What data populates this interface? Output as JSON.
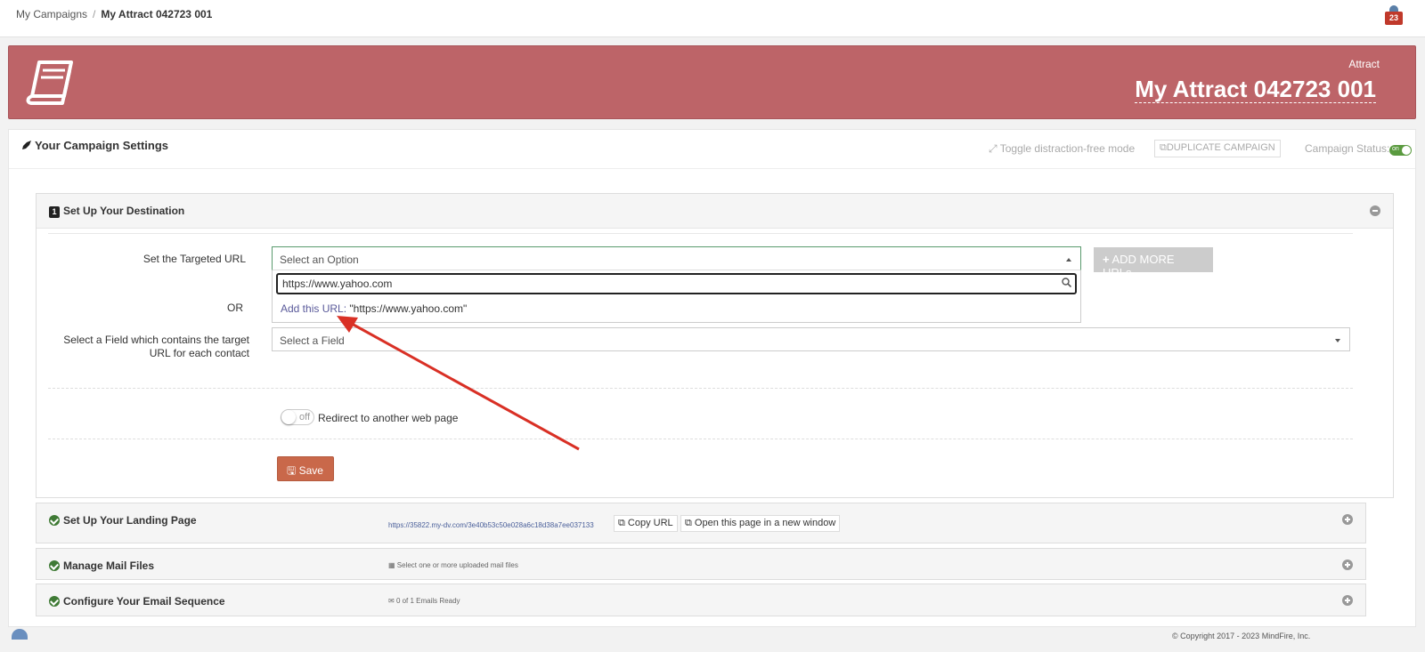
{
  "breadcrumb": {
    "root": "My Campaigns",
    "separator": "/",
    "current": "My Attract 042723 001"
  },
  "notifications": {
    "count": "23"
  },
  "banner": {
    "type": "Attract",
    "campaign_name": "My Attract 042723 001",
    "color": "#bd6468"
  },
  "settings": {
    "title": "Your Campaign Settings",
    "toggle_mode": "Toggle distraction-free mode",
    "duplicate": "DUPLICATE CAMPAIGN",
    "status_label": "Campaign Status:",
    "status_value": "on"
  },
  "destination": {
    "step": "1",
    "title": "Set Up Your Destination",
    "targeted_url_label": "Set the Targeted URL",
    "select_placeholder": "Select an Option",
    "search_value": "https://www.yahoo.com",
    "add_url_prefix": "Add this URL:",
    "add_url_value": " \"https://www.yahoo.com\"",
    "add_more": "ADD MORE URLs",
    "or_label": "OR",
    "field_label": "Select a Field which contains the target URL for each contact",
    "field_placeholder": "Select a Field",
    "redirect_toggle": "off",
    "redirect_label": "Redirect to another web page",
    "save": "Save"
  },
  "landing": {
    "title": "Set Up Your Landing Page",
    "url": "https://35822.my-dv.com/3e40b53c50e028a6c18d38a7ee037133",
    "copy_url": "Copy URL",
    "open_window": "Open this page in a new window"
  },
  "mail_files": {
    "title": "Manage Mail Files",
    "hint": "Select one or more uploaded mail files"
  },
  "email_seq": {
    "title": "Configure Your Email Sequence",
    "hint": "0 of 1 Emails Ready"
  },
  "footer": {
    "copyright": "© Copyright 2017 - 2023 MindFire, Inc."
  }
}
